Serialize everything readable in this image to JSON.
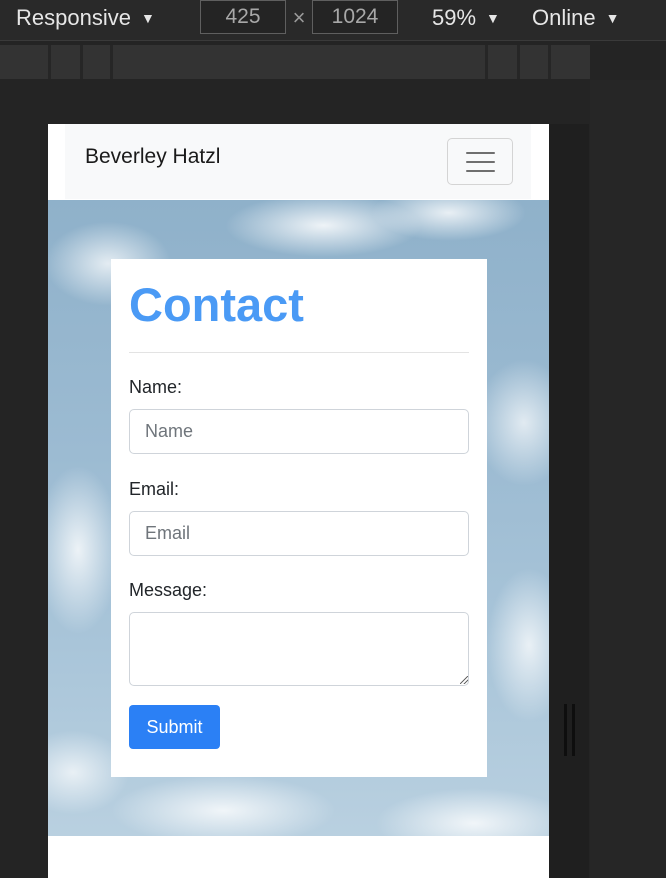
{
  "devtools": {
    "device_label": "Responsive",
    "width": "425",
    "times": "×",
    "height": "1024",
    "zoom": "59%",
    "throttle": "Online",
    "caret": "▼"
  },
  "site": {
    "brand": "Beverley Hatzl",
    "toggler_icon": "hamburger-menu-icon"
  },
  "contact": {
    "title": "Contact",
    "name_label": "Name:",
    "name_placeholder": "Name",
    "name_value": "",
    "email_label": "Email:",
    "email_placeholder": "Email",
    "email_value": "",
    "message_label": "Message:",
    "message_value": "",
    "submit_label": "Submit"
  },
  "colors": {
    "heading": "#4a9af5",
    "button": "#2b80f5",
    "navbar_bg": "#f8f9fa",
    "devtools_bg": "#292929"
  }
}
